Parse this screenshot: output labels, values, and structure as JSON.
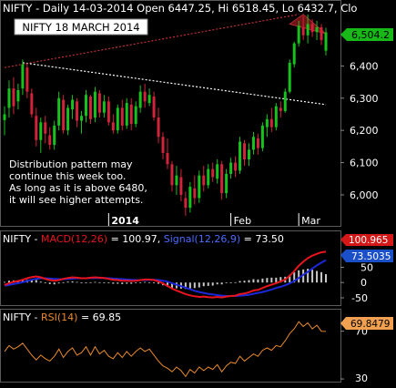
{
  "header": {
    "text": "NIFTY - Daily 14-03-2014 Open 6447.25, Hi 6518.45, Lo 6432.7, Clo",
    "title_box": "NIFTY  18 MARCH 2014"
  },
  "annotation": {
    "lines": [
      "Distribution pattern may",
      "continue this week too.",
      "As long as it is above 6480,",
      "it will see higher attempts."
    ]
  },
  "colors": {
    "background": "#000000",
    "panel_border": "#5a5a5a",
    "bull_candle": "#17c21d",
    "bear_candle": "#d1233a",
    "trendline_upper": "#c0303a",
    "trendline_lower": "#ffffff",
    "triangle_fill": "#7a1418",
    "macd_line": "#e8141e",
    "signal_line": "#1c28d8",
    "histogram": "#c8c8c8",
    "rsi_line": "#e88a2c",
    "last_price_badge": "#18b818",
    "macd_badge": "#d41818",
    "signal_badge": "#1a4fc8",
    "rsi_badge": "#f0a050"
  },
  "chart_data": [
    {
      "type": "candlestick",
      "title": "NIFTY - Daily 14-03-2014",
      "ohlc_last": {
        "date": "14-03-2014",
        "open": 6447.25,
        "high": 6518.45,
        "low": 6432.7,
        "close": 6504.2
      },
      "last_price_label": "6,504.2",
      "y_ticks": [
        "6,400",
        "6,300",
        "6,200",
        "6,100",
        "6,000"
      ],
      "y_tick_values": [
        6400,
        6300,
        6200,
        6100,
        6000
      ],
      "ylim": [
        5915,
        6565
      ],
      "x_labels": [
        "2014",
        "Feb",
        "Mar"
      ],
      "x_label_positions": [
        23,
        50,
        65
      ],
      "n_bars": 72,
      "candles": [
        {
          "o": 6232,
          "h": 6275,
          "l": 6185,
          "c": 6250
        },
        {
          "o": 6270,
          "h": 6355,
          "l": 6240,
          "c": 6330
        },
        {
          "o": 6330,
          "h": 6365,
          "l": 6250,
          "c": 6275
        },
        {
          "o": 6290,
          "h": 6345,
          "l": 6265,
          "c": 6325
        },
        {
          "o": 6330,
          "h": 6420,
          "l": 6310,
          "c": 6405
        },
        {
          "o": 6395,
          "h": 6410,
          "l": 6300,
          "c": 6320
        },
        {
          "o": 6315,
          "h": 6330,
          "l": 6240,
          "c": 6250
        },
        {
          "o": 6245,
          "h": 6270,
          "l": 6150,
          "c": 6170
        },
        {
          "o": 6170,
          "h": 6240,
          "l": 6130,
          "c": 6225
        },
        {
          "o": 6225,
          "h": 6245,
          "l": 6160,
          "c": 6190
        },
        {
          "o": 6185,
          "h": 6210,
          "l": 6140,
          "c": 6155
        },
        {
          "o": 6155,
          "h": 6230,
          "l": 6140,
          "c": 6215
        },
        {
          "o": 6215,
          "h": 6320,
          "l": 6200,
          "c": 6300
        },
        {
          "o": 6295,
          "h": 6310,
          "l": 6190,
          "c": 6200
        },
        {
          "o": 6200,
          "h": 6280,
          "l": 6185,
          "c": 6270
        },
        {
          "o": 6265,
          "h": 6310,
          "l": 6235,
          "c": 6295
        },
        {
          "o": 6290,
          "h": 6300,
          "l": 6210,
          "c": 6230
        },
        {
          "o": 6230,
          "h": 6260,
          "l": 6190,
          "c": 6245
        },
        {
          "o": 6245,
          "h": 6325,
          "l": 6225,
          "c": 6310
        },
        {
          "o": 6305,
          "h": 6310,
          "l": 6220,
          "c": 6235
        },
        {
          "o": 6240,
          "h": 6335,
          "l": 6225,
          "c": 6320
        },
        {
          "o": 6315,
          "h": 6325,
          "l": 6240,
          "c": 6255
        },
        {
          "o": 6255,
          "h": 6310,
          "l": 6240,
          "c": 6290
        },
        {
          "o": 6290,
          "h": 6305,
          "l": 6215,
          "c": 6225
        },
        {
          "o": 6225,
          "h": 6250,
          "l": 6190,
          "c": 6200
        },
        {
          "o": 6200,
          "h": 6280,
          "l": 6190,
          "c": 6270
        },
        {
          "o": 6270,
          "h": 6295,
          "l": 6200,
          "c": 6215
        },
        {
          "o": 6215,
          "h": 6300,
          "l": 6205,
          "c": 6285
        },
        {
          "o": 6280,
          "h": 6300,
          "l": 6200,
          "c": 6220
        },
        {
          "o": 6220,
          "h": 6290,
          "l": 6210,
          "c": 6275
        },
        {
          "o": 6270,
          "h": 6340,
          "l": 6255,
          "c": 6320
        },
        {
          "o": 6320,
          "h": 6345,
          "l": 6270,
          "c": 6290
        },
        {
          "o": 6285,
          "h": 6330,
          "l": 6275,
          "c": 6310
        },
        {
          "o": 6305,
          "h": 6320,
          "l": 6230,
          "c": 6240
        },
        {
          "o": 6240,
          "h": 6270,
          "l": 6160,
          "c": 6180
        },
        {
          "o": 6180,
          "h": 6195,
          "l": 6110,
          "c": 6130
        },
        {
          "o": 6130,
          "h": 6175,
          "l": 6080,
          "c": 6095
        },
        {
          "o": 6095,
          "h": 6105,
          "l": 6010,
          "c": 6030
        },
        {
          "o": 6030,
          "h": 6090,
          "l": 6000,
          "c": 6060
        },
        {
          "o": 6055,
          "h": 6080,
          "l": 5980,
          "c": 6000
        },
        {
          "o": 5990,
          "h": 6010,
          "l": 5935,
          "c": 5960
        },
        {
          "o": 5960,
          "h": 6040,
          "l": 5945,
          "c": 6025
        },
        {
          "o": 6020,
          "h": 6060,
          "l": 5970,
          "c": 5990
        },
        {
          "o": 5990,
          "h": 6075,
          "l": 5975,
          "c": 6060
        },
        {
          "o": 6060,
          "h": 6090,
          "l": 6010,
          "c": 6030
        },
        {
          "o": 6030,
          "h": 6095,
          "l": 6020,
          "c": 6080
        },
        {
          "o": 6080,
          "h": 6100,
          "l": 6040,
          "c": 6055
        },
        {
          "o": 6050,
          "h": 6110,
          "l": 6035,
          "c": 6095
        },
        {
          "o": 6095,
          "h": 6105,
          "l": 5985,
          "c": 6005
        },
        {
          "o": 6005,
          "h": 6080,
          "l": 5990,
          "c": 6065
        },
        {
          "o": 6065,
          "h": 6115,
          "l": 6050,
          "c": 6100
        },
        {
          "o": 6100,
          "h": 6120,
          "l": 6055,
          "c": 6075
        },
        {
          "o": 6075,
          "h": 6180,
          "l": 6065,
          "c": 6165
        },
        {
          "o": 6160,
          "h": 6170,
          "l": 6090,
          "c": 6110
        },
        {
          "o": 6110,
          "h": 6160,
          "l": 6090,
          "c": 6140
        },
        {
          "o": 6140,
          "h": 6195,
          "l": 6125,
          "c": 6180
        },
        {
          "o": 6175,
          "h": 6190,
          "l": 6125,
          "c": 6145
        },
        {
          "o": 6145,
          "h": 6225,
          "l": 6135,
          "c": 6215
        },
        {
          "o": 6210,
          "h": 6250,
          "l": 6180,
          "c": 6235
        },
        {
          "o": 6235,
          "h": 6270,
          "l": 6195,
          "c": 6210
        },
        {
          "o": 6210,
          "h": 6285,
          "l": 6200,
          "c": 6275
        },
        {
          "o": 6270,
          "h": 6290,
          "l": 6240,
          "c": 6260
        },
        {
          "o": 6260,
          "h": 6330,
          "l": 6255,
          "c": 6320
        },
        {
          "o": 6320,
          "h": 6420,
          "l": 6315,
          "c": 6410
        },
        {
          "o": 6405,
          "h": 6475,
          "l": 6395,
          "c": 6470
        },
        {
          "o": 6470,
          "h": 6540,
          "l": 6460,
          "c": 6525
        },
        {
          "o": 6520,
          "h": 6555,
          "l": 6480,
          "c": 6495
        },
        {
          "o": 6495,
          "h": 6560,
          "l": 6470,
          "c": 6530
        },
        {
          "o": 6530,
          "h": 6545,
          "l": 6490,
          "c": 6505
        },
        {
          "o": 6505,
          "h": 6540,
          "l": 6480,
          "c": 6520
        },
        {
          "o": 6520,
          "h": 6530,
          "l": 6465,
          "c": 6480
        },
        {
          "o": 6447.25,
          "h": 6518.45,
          "l": 6432.7,
          "c": 6504.2
        }
      ],
      "trendlines": [
        {
          "style": "dotted",
          "color": "upper",
          "x1": 0,
          "y1": 6395,
          "x2": 65,
          "y2": 6560
        },
        {
          "style": "dotted",
          "color": "lower",
          "x1": 4,
          "y1": 6410,
          "x2": 71,
          "y2": 6280
        }
      ],
      "triangle": {
        "points": [
          [
            63,
            6530
          ],
          [
            66,
            6560
          ],
          [
            71,
            6500
          ]
        ]
      }
    },
    {
      "type": "line",
      "title": "MACD(12,26) / Signal(12,26,9)",
      "label_prefix": "NIFTY -",
      "macd_name": "MACD(12,26)",
      "macd_value": "= 100.97,",
      "signal_name": "Signal(12,26,9)",
      "signal_value": "= 73.50",
      "y_ticks": [
        "50",
        "0",
        "-50"
      ],
      "y_tick_values": [
        50,
        0,
        -50
      ],
      "ylim": [
        -68,
        120
      ],
      "badge_macd": "100.965",
      "badge_signal": "73.5035",
      "macd": [
        -8,
        -2,
        2,
        5,
        9,
        14,
        18,
        20,
        17,
        12,
        8,
        6,
        8,
        12,
        15,
        17,
        16,
        14,
        14,
        16,
        17,
        16,
        15,
        12,
        9,
        8,
        6,
        6,
        5,
        6,
        8,
        10,
        10,
        8,
        4,
        -3,
        -11,
        -20,
        -26,
        -32,
        -38,
        -42,
        -45,
        -47,
        -46,
        -48,
        -49,
        -47,
        -49,
        -46,
        -44,
        -43,
        -38,
        -36,
        -32,
        -26,
        -24,
        -18,
        -12,
        -7,
        -2,
        4,
        10,
        22,
        38,
        55,
        68,
        80,
        88,
        94,
        99,
        101
      ],
      "signal": [
        -10,
        -8,
        -5,
        -2,
        1,
        5,
        9,
        12,
        14,
        14,
        13,
        12,
        11,
        11,
        12,
        13,
        14,
        14,
        14,
        15,
        15,
        15,
        15,
        14,
        13,
        12,
        11,
        10,
        9,
        8,
        8,
        8,
        9,
        9,
        8,
        6,
        3,
        -2,
        -7,
        -12,
        -17,
        -22,
        -27,
        -31,
        -34,
        -37,
        -39,
        -41,
        -43,
        -44,
        -44,
        -44,
        -43,
        -42,
        -40,
        -37,
        -34,
        -31,
        -27,
        -23,
        -18,
        -14,
        -9,
        -3,
        5,
        15,
        25,
        35,
        46,
        56,
        65,
        73.5
      ],
      "histogram": [
        2,
        6,
        7,
        7,
        8,
        9,
        9,
        8,
        3,
        -2,
        -5,
        -6,
        -3,
        1,
        3,
        4,
        2,
        0,
        0,
        1,
        2,
        1,
        0,
        -2,
        -4,
        -4,
        -5,
        -4,
        -4,
        -2,
        0,
        2,
        1,
        -1,
        -4,
        -9,
        -14,
        -18,
        -19,
        -20,
        -21,
        -20,
        -18,
        -16,
        -12,
        -11,
        -10,
        -6,
        -6,
        -2,
        0,
        1,
        5,
        6,
        8,
        11,
        10,
        13,
        15,
        16,
        16,
        18,
        19,
        25,
        33,
        40,
        43,
        45,
        42,
        38,
        34,
        27.5
      ]
    },
    {
      "type": "line",
      "title": "RSI(14)",
      "label_prefix": "NIFTY -",
      "rsi_name": "RSI(14)",
      "rsi_value": "= 69.85",
      "y_ticks": [
        "70",
        "30"
      ],
      "y_tick_values": [
        70,
        30
      ],
      "ylim": [
        27,
        85
      ],
      "badge_rsi": "69.8479",
      "rsi": [
        53,
        58,
        55,
        57,
        60,
        55,
        50,
        46,
        50,
        47,
        45,
        49,
        55,
        48,
        53,
        56,
        50,
        52,
        57,
        50,
        57,
        51,
        54,
        49,
        47,
        52,
        48,
        53,
        49,
        53,
        56,
        53,
        55,
        50,
        45,
        41,
        39,
        36,
        40,
        37,
        32,
        38,
        35,
        40,
        37,
        40,
        38,
        42,
        36,
        41,
        44,
        43,
        49,
        45,
        48,
        51,
        49,
        54,
        56,
        54,
        58,
        57,
        62,
        68,
        72,
        78,
        74,
        77,
        72,
        75,
        70,
        69.85
      ]
    }
  ]
}
